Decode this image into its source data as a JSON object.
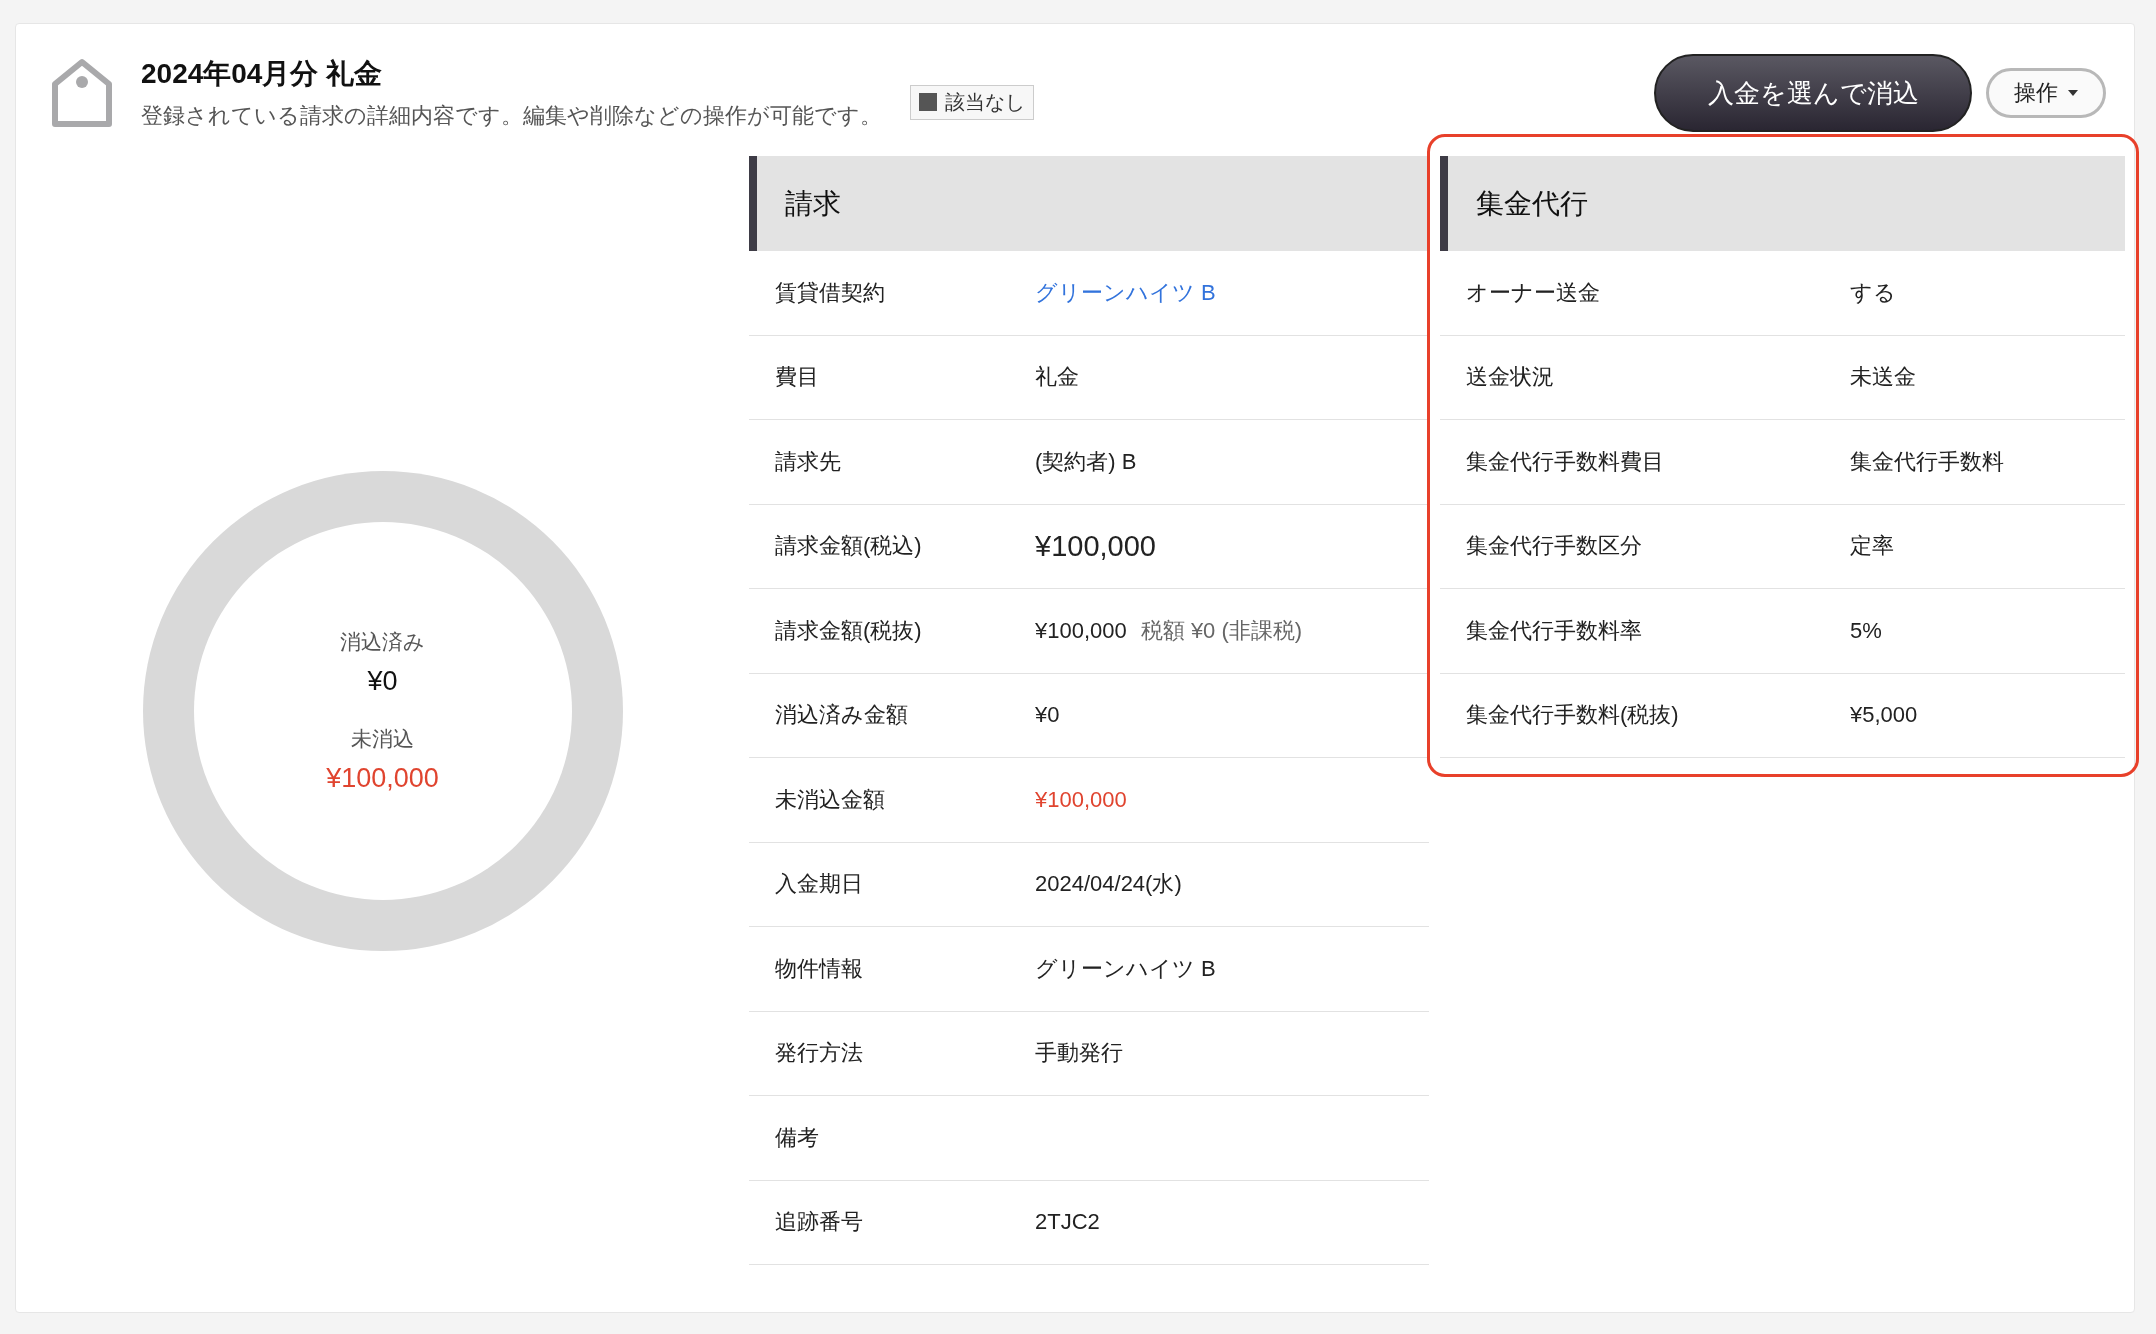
{
  "header": {
    "title": "2024年04月分 礼金",
    "subtitle": "登録されている請求の詳細内容です。編集や削除などの操作が可能です。",
    "badge": "該当なし"
  },
  "buttons": {
    "primary": "入金を選んで消込",
    "menu": "操作"
  },
  "donut": {
    "paid_label": "消込済み",
    "paid_amount": "¥0",
    "unpaid_label": "未消込",
    "unpaid_amount": "¥100,000"
  },
  "sections": [
    {
      "title": "請求",
      "highlighted": false,
      "rows": [
        {
          "label": "賃貸借契約",
          "kind": "link",
          "value": "グリーンハイツ B"
        },
        {
          "label": "費目",
          "kind": "text",
          "value": "礼金"
        },
        {
          "label": "請求先",
          "kind": "text",
          "value": "(契約者) B"
        },
        {
          "label": "請求金額(税込)",
          "kind": "large",
          "value": "¥100,000"
        },
        {
          "label": "請求金額(税抜)",
          "kind": "text",
          "value": "¥100,000",
          "note": "税額 ¥0 (非課税)"
        },
        {
          "label": "消込済み金額",
          "kind": "text",
          "value": "¥0"
        },
        {
          "label": "未消込金額",
          "kind": "alert",
          "value": "¥100,000"
        },
        {
          "label": "入金期日",
          "kind": "text",
          "value": "2024/04/24(水)"
        },
        {
          "label": "物件情報",
          "kind": "text",
          "value": "グリーンハイツ B"
        },
        {
          "label": "発行方法",
          "kind": "text",
          "value": "手動発行"
        },
        {
          "label": "備考"
        },
        {
          "label": "追跡番号",
          "kind": "text",
          "value": "2TJC2"
        }
      ]
    },
    {
      "title": "集金代行",
      "highlighted": true,
      "rows": [
        {
          "label": "オーナー送金",
          "kind": "text",
          "value": "する"
        },
        {
          "label": "送金状況",
          "kind": "text",
          "value": "未送金"
        },
        {
          "label": "集金代行手数料費目",
          "kind": "text",
          "value": "集金代行手数料"
        },
        {
          "label": "集金代行手数区分",
          "kind": "text",
          "value": "定率"
        },
        {
          "label": "集金代行手数料率",
          "kind": "text",
          "value": "5%"
        },
        {
          "label": "集金代行手数料(税抜)",
          "kind": "text",
          "value": "¥5,000"
        }
      ]
    }
  ]
}
